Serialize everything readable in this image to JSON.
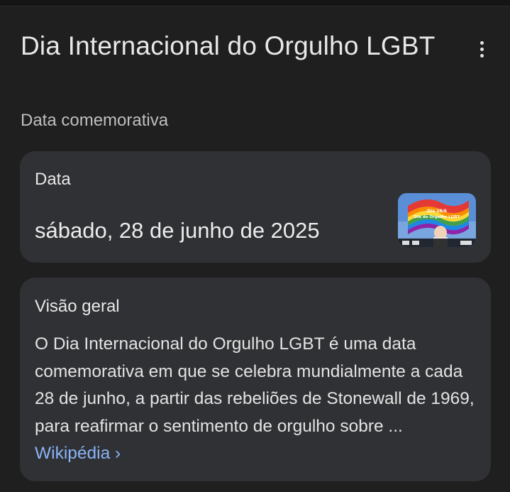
{
  "header": {
    "title": "Dia Internacional do Orgulho LGBT",
    "subtitle": "Data comemorativa"
  },
  "date_card": {
    "label": "Data",
    "value": "sábado, 28 de junho de 2025",
    "thumbnail": {
      "caption_line1": "Dia 28/6",
      "caption_line2": "Dia do Orgulho LGBT"
    }
  },
  "overview_card": {
    "label": "Visão geral",
    "text": "O Dia Internacional do Orgulho LGBT é uma data comemorativa em que se celebra mundialmente a cada 28 de junho, a partir das rebeliões de Stonewall de 1969, para reafirmar o sentimento de orgulho sobre ...",
    "link_label": "Wikipédia",
    "link_chevron": "›"
  },
  "icons": {
    "menu": "more-vert-icon"
  },
  "colors": {
    "background": "#1f1f1f",
    "card": "#303134",
    "link": "#8ab4f8"
  }
}
